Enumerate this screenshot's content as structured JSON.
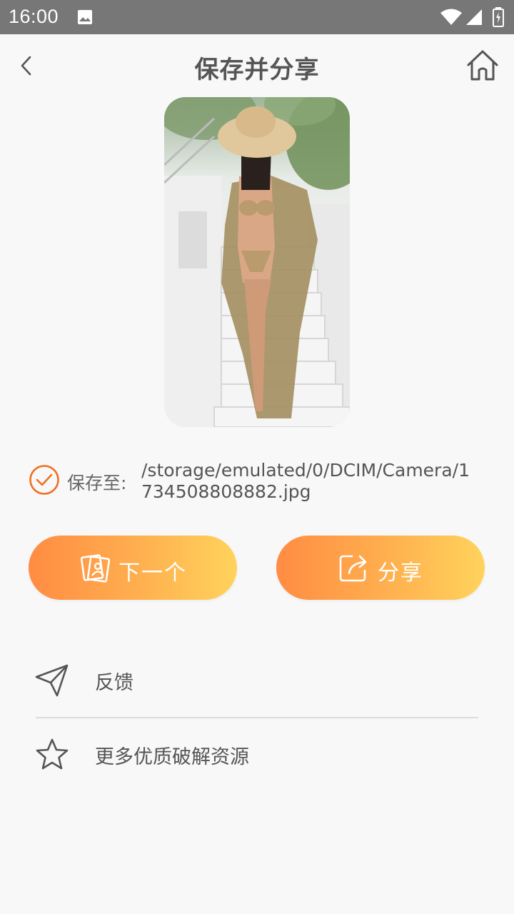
{
  "status_bar": {
    "time": "16:00",
    "icons": [
      "image-icon",
      "wifi-icon",
      "signal-icon",
      "battery-icon"
    ]
  },
  "header": {
    "title": "保存并分享",
    "back_icon": "chevron-left-icon",
    "home_icon": "home-icon"
  },
  "preview": {
    "image": "photo-preview"
  },
  "save_info": {
    "label": "保存至:",
    "path": "/storage/emulated/0/DCIM/Camera/1734508808882.jpg",
    "icon": "check-circle-icon"
  },
  "actions": {
    "next_label": "下一个",
    "share_label": "分享"
  },
  "menu": {
    "items": [
      {
        "label": "反馈",
        "icon": "paper-plane-icon"
      },
      {
        "label": "更多优质破解资源",
        "icon": "star-icon"
      }
    ]
  },
  "colors": {
    "accent_start": "#ff8c43",
    "accent_end": "#ffd35c",
    "check": "#f07020",
    "status_bar": "#777777"
  }
}
